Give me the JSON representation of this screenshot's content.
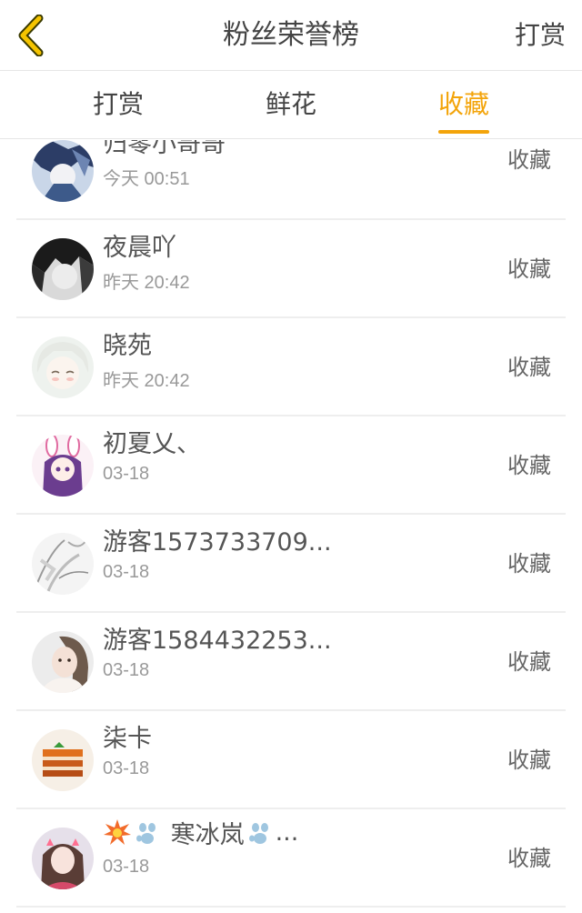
{
  "header": {
    "title": "粉丝荣誉榜",
    "right_link": "打赏"
  },
  "tabs": [
    {
      "label": "打赏",
      "active": false
    },
    {
      "label": "鲜花",
      "active": false
    },
    {
      "label": "收藏",
      "active": true
    }
  ],
  "colors": {
    "accent": "#f3a40a",
    "back_arrow": "#f5c400",
    "text": "#444444",
    "secondary_text": "#999999"
  },
  "list": [
    {
      "name": "归零小哥哥",
      "time": "今天 00:51",
      "action": "收藏",
      "avatar_icon": "anime-boy-blue-avatar"
    },
    {
      "name": "夜晨吖",
      "time": "昨天 20:42",
      "action": "收藏",
      "avatar_icon": "anime-dark-hair-avatar"
    },
    {
      "name": "晓苑",
      "time": "昨天 20:42",
      "action": "收藏",
      "avatar_icon": "anime-white-hair-avatar"
    },
    {
      "name": "初夏乂、",
      "time": "03-18",
      "action": "收藏",
      "avatar_icon": "anime-bunny-ears-avatar"
    },
    {
      "name": "游客1573733709...",
      "time": "03-18",
      "action": "收藏",
      "avatar_icon": "sketch-avatar"
    },
    {
      "name": "游客1584432253...",
      "time": "03-18",
      "action": "收藏",
      "avatar_icon": "girl-photo-avatar"
    },
    {
      "name": "柒卡",
      "time": "03-18",
      "action": "收藏",
      "avatar_icon": "cake-avatar"
    },
    {
      "name": "寒冰岚",
      "name_prefix_icons": [
        "boom-icon",
        "paw-icon"
      ],
      "name_suffix_icon": "paw-icon",
      "name_ellipsis": "...",
      "time": "03-18",
      "action": "收藏",
      "avatar_icon": "girl-pink-photo-avatar"
    }
  ]
}
